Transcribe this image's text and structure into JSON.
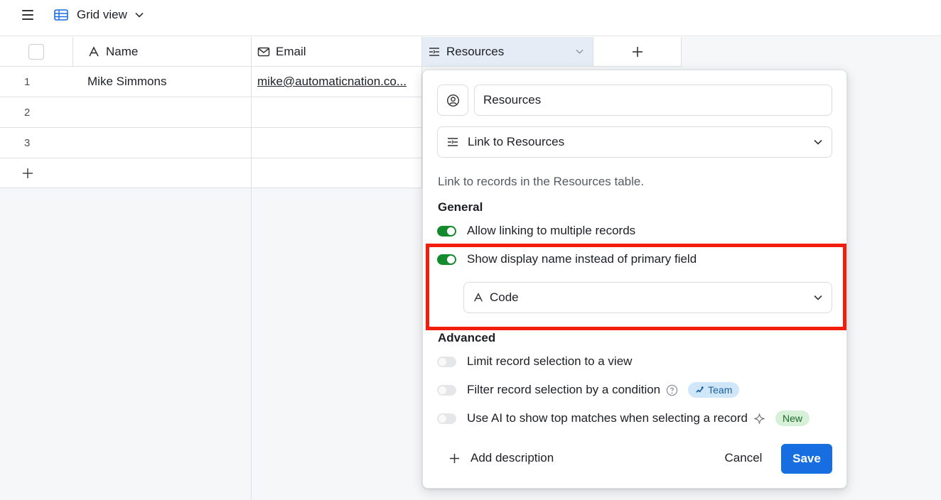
{
  "toolbar": {
    "view_name": "Grid view"
  },
  "grid": {
    "columns": [
      {
        "label": "Name",
        "icon": "text-field-icon"
      },
      {
        "label": "Email",
        "icon": "email-icon"
      },
      {
        "label": "Resources",
        "icon": "linked-record-icon"
      }
    ],
    "rows": [
      {
        "num": "1",
        "name": "Mike Simmons",
        "email": "mike@automaticnation.co..."
      },
      {
        "num": "2",
        "name": "",
        "email": ""
      },
      {
        "num": "3",
        "name": "",
        "email": ""
      }
    ]
  },
  "popup": {
    "field_name": "Resources",
    "field_type": "Link to Resources",
    "description": "Link to records in the Resources table.",
    "general_title": "General",
    "allow_multiple_label": "Allow linking to multiple records",
    "allow_multiple_on": true,
    "show_display_name_label": "Show display name instead of primary field",
    "show_display_name_on": true,
    "display_field": "Code",
    "advanced_title": "Advanced",
    "limit_view_label": "Limit record selection to a view",
    "limit_view_on": false,
    "filter_condition_label": "Filter record selection by a condition",
    "filter_condition_on": false,
    "team_badge": "Team",
    "ai_matches_label": "Use AI to show top matches when selecting a record",
    "ai_matches_on": false,
    "new_badge": "New",
    "add_description_label": "Add description",
    "cancel_label": "Cancel",
    "save_label": "Save"
  },
  "colors": {
    "accent": "#166ee1",
    "toggle_on": "#138a2e",
    "highlight": "#f21d0d",
    "header_selected": "#e6ecf6"
  }
}
